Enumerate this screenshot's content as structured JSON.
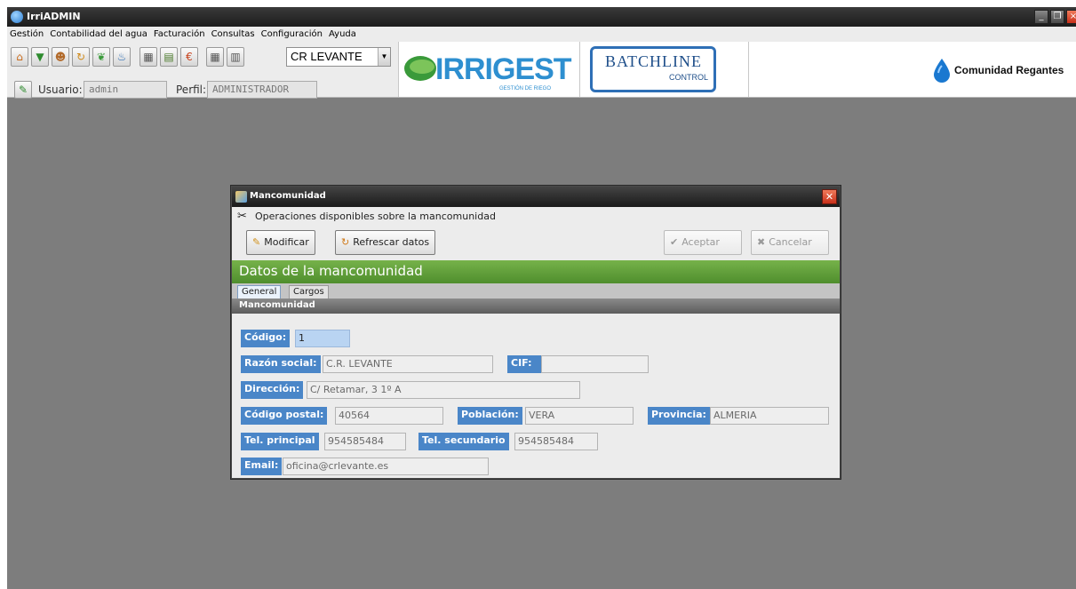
{
  "window": {
    "title": "IrriADMIN"
  },
  "menu": [
    "Gestión",
    "Contabilidad del agua",
    "Facturación",
    "Consultas",
    "Configuración",
    "Ayuda"
  ],
  "toolbar": {
    "icons": [
      "home-icon",
      "arrow-down-icon",
      "person-icon",
      "refresh-icon",
      "plant-icon",
      "water-tap-icon",
      "calculator-icon",
      "document-icon",
      "euro-icon",
      "calculator-2-icon",
      "report-icon"
    ],
    "community_select": "CR LEVANTE",
    "user_label": "Usuario:",
    "user_value": "admin",
    "profile_label": "Perfil:",
    "profile_value": "ADMINISTRADOR"
  },
  "logos": {
    "irrigest": "IRRIGEST",
    "irrigest_sub": "GESTIÓN DE RIEGO",
    "batchline": "BATCHLINE",
    "batchline_sub": "CONTROL",
    "comunidad": "Comunidad Regantes"
  },
  "dialog": {
    "title": "Mancomunidad",
    "ops_label": "Operaciones disponibles sobre la mancomunidad",
    "buttons": {
      "modify": "Modificar",
      "refresh": "Refrescar datos",
      "accept": "Aceptar",
      "cancel": "Cancelar"
    },
    "section_title": "Datos de la mancomunidad",
    "tabs": [
      "General",
      "Cargos"
    ],
    "subheader": "Mancomunidad",
    "fields": {
      "codigo": {
        "label": "Código:",
        "value": "1"
      },
      "razon_social": {
        "label": "Razón social:",
        "value": "C.R. LEVANTE"
      },
      "cif": {
        "label": "CIF:",
        "value": ""
      },
      "direccion": {
        "label": "Dirección:",
        "value": "C/ Retamar, 3 1º A"
      },
      "codigo_postal": {
        "label": "Código postal:",
        "value": "40564"
      },
      "poblacion": {
        "label": "Población:",
        "value": "VERA"
      },
      "provincia": {
        "label": "Provincia:",
        "value": "ALMERIA"
      },
      "tel_principal": {
        "label": "Tel. principal",
        "value": "954585484"
      },
      "tel_secundario": {
        "label": "Tel. secundario",
        "value": "954585484"
      },
      "email": {
        "label": "Email:",
        "value": "oficina@crlevante.es"
      }
    }
  },
  "colors": {
    "desktop": "#7d7d7d",
    "section_green": "#5a9a36",
    "field_label_blue": "#4a86c8"
  }
}
